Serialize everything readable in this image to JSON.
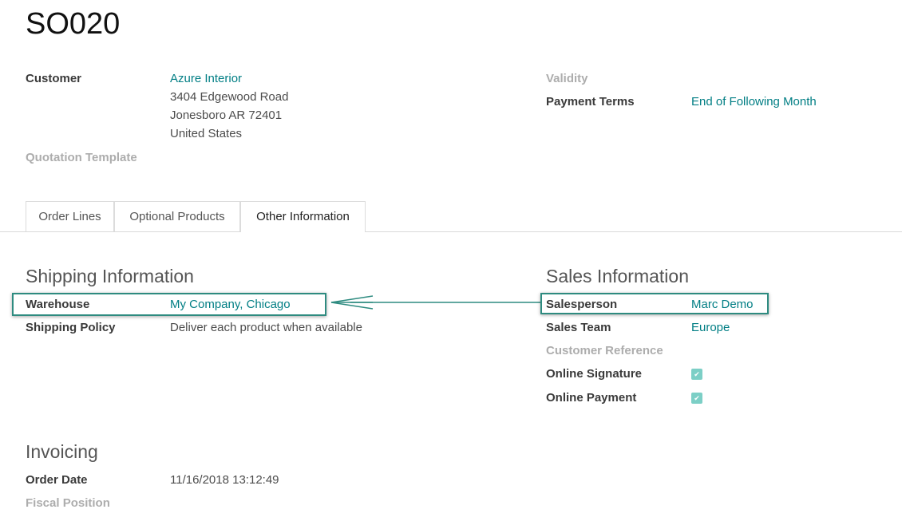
{
  "record": {
    "title": "SO020"
  },
  "customer": {
    "label": "Customer",
    "name": "Azure Interior",
    "address": [
      "3404 Edgewood Road",
      "Jonesboro AR 72401",
      "United States"
    ]
  },
  "quotation_template": {
    "label": "Quotation Template"
  },
  "validity": {
    "label": "Validity"
  },
  "payment_terms": {
    "label": "Payment Terms",
    "value": "End of Following Month"
  },
  "tabs": [
    {
      "label": "Order Lines"
    },
    {
      "label": "Optional Products"
    },
    {
      "label": "Other Information",
      "active": true
    }
  ],
  "shipping": {
    "title": "Shipping Information",
    "warehouse_label": "Warehouse",
    "warehouse_value": "My Company, Chicago",
    "policy_label": "Shipping Policy",
    "policy_value": "Deliver each product when available"
  },
  "sales": {
    "title": "Sales Information",
    "salesperson_label": "Salesperson",
    "salesperson_value": "Marc Demo",
    "team_label": "Sales Team",
    "team_value": "Europe",
    "customer_ref_label": "Customer Reference",
    "online_signature_label": "Online Signature",
    "online_signature_checked": true,
    "online_payment_label": "Online Payment",
    "online_payment_checked": true
  },
  "invoicing": {
    "title": "Invoicing",
    "order_date_label": "Order Date",
    "order_date_value": "11/16/2018 13:12:49",
    "fiscal_position_label": "Fiscal Position"
  },
  "colors": {
    "link": "#017e84",
    "highlight": "#2e8b80",
    "checkbox": "#7ccfc6"
  }
}
